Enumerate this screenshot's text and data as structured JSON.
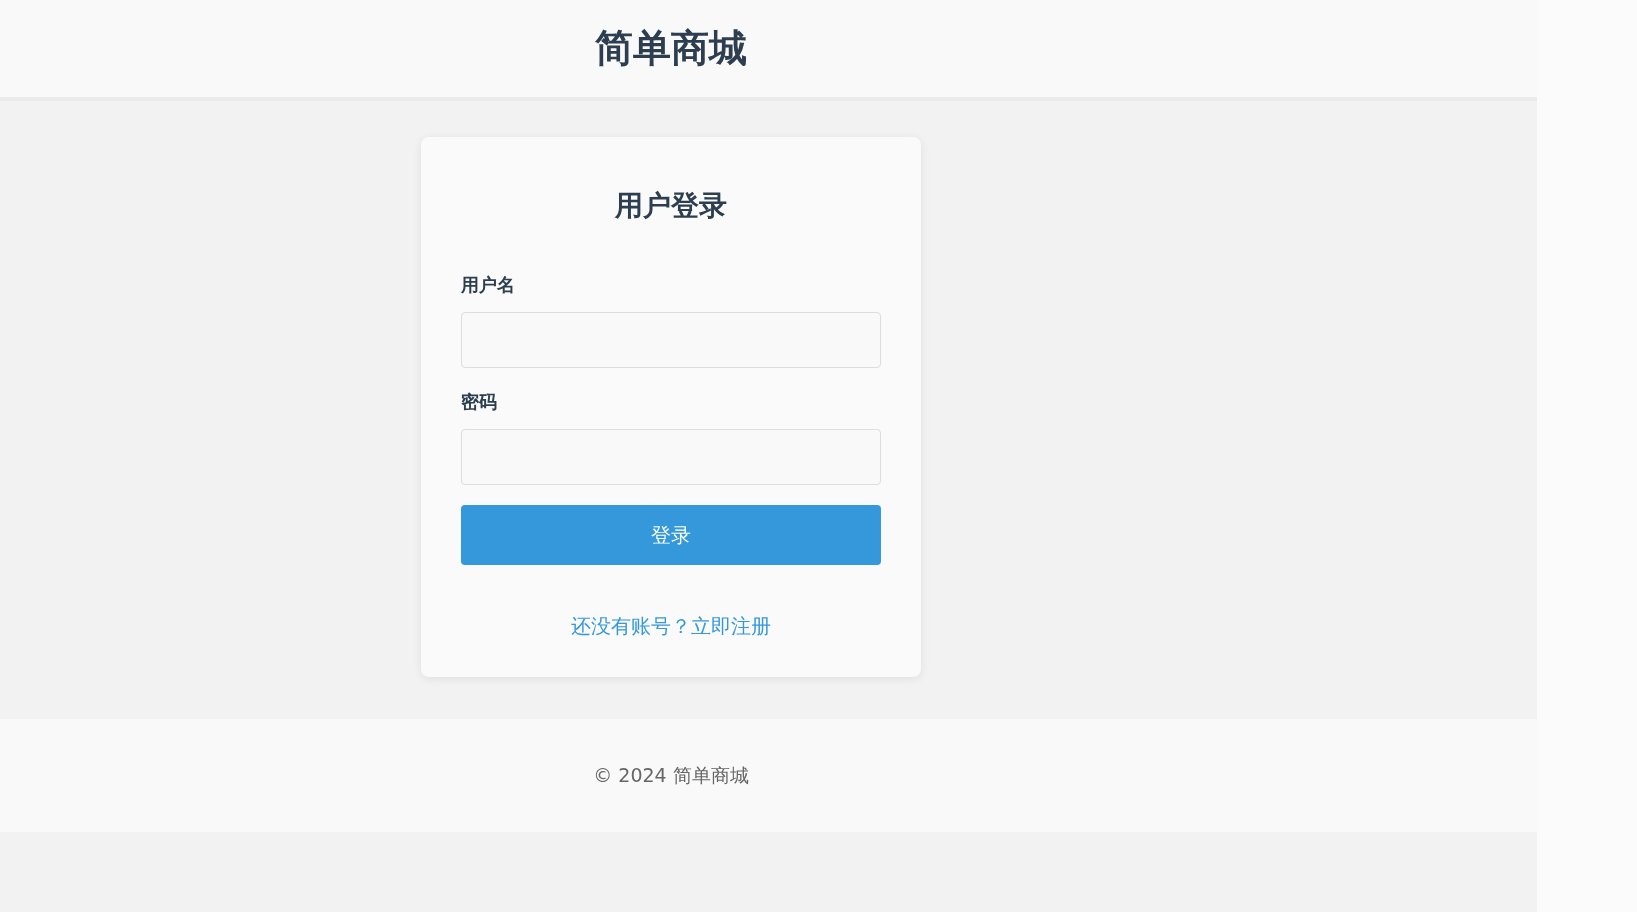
{
  "header": {
    "title": "简单商城"
  },
  "login": {
    "title": "用户登录",
    "fields": [
      {
        "label": "用户名"
      },
      {
        "label": "密码"
      }
    ],
    "submit": "登录",
    "register_link": "还没有账号？立即注册"
  },
  "footer": {
    "text": "© 2024 简单商城"
  }
}
